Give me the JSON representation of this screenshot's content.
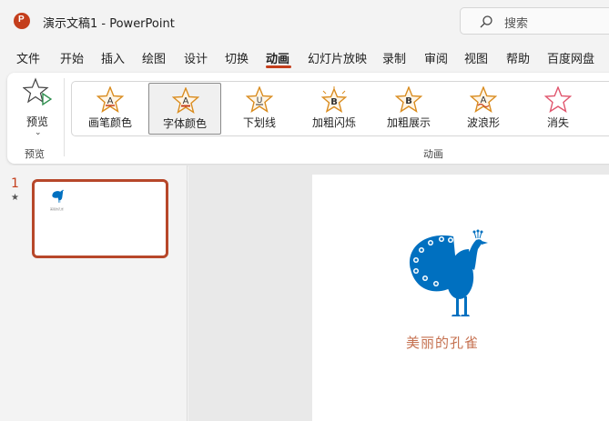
{
  "app": {
    "title": "演示文稿1  -  PowerPoint",
    "logo_letter": "P",
    "brand_color": "#c43e1c"
  },
  "search": {
    "label": "搜索",
    "icon": "search-icon"
  },
  "menu": {
    "tabs": [
      "文件",
      "开始",
      "插入",
      "绘图",
      "设计",
      "切换",
      "动画",
      "幻灯片放映",
      "录制",
      "审阅",
      "视图",
      "帮助",
      "百度网盘"
    ],
    "active": "动画"
  },
  "ribbon": {
    "preview": {
      "label": "预览",
      "dropdown": "⌄",
      "group_label": "预览",
      "icon": "star-play-icon"
    },
    "animations": {
      "group_label": "动画",
      "items": [
        {
          "label": "画笔颜色",
          "glyph": "A",
          "icon": "star-a-icon"
        },
        {
          "label": "字体颜色",
          "glyph": "A",
          "icon": "star-a-underline-icon",
          "selected": true
        },
        {
          "label": "下划线",
          "glyph": "U",
          "icon": "star-u-icon"
        },
        {
          "label": "加粗闪烁",
          "glyph": "B",
          "icon": "star-b-burst-icon"
        },
        {
          "label": "加粗展示",
          "glyph": "B",
          "icon": "star-b-icon"
        },
        {
          "label": "波浪形",
          "glyph": "A",
          "icon": "star-wave-icon"
        },
        {
          "label": "消失",
          "glyph": "",
          "icon": "star-outline-icon"
        }
      ]
    }
  },
  "thumbnails": {
    "slide_number": "1",
    "star": "★",
    "caption": "美丽的孔雀"
  },
  "slide": {
    "caption": "美丽的孔雀",
    "peacock_color": "#0070c0",
    "caption_color": "#c5704f"
  }
}
